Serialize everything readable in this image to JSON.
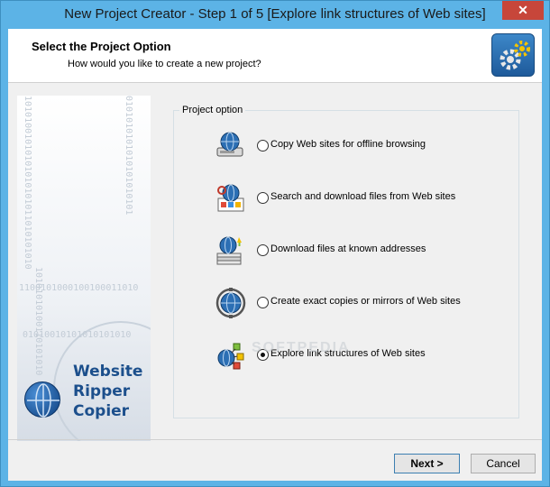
{
  "window": {
    "title": "New Project Creator - Step 1 of 5 [Explore link structures of Web sites]",
    "close_glyph": "✕"
  },
  "header": {
    "title": "Select the Project Option",
    "subtitle": "How would you like to create a new project?",
    "icon": "gears-icon"
  },
  "banner": {
    "bits_rows": [
      "1100101000100100011010",
      "01010010101010101010"
    ],
    "bits_columns": [
      "10101001010101010101011010101010",
      "0101010101010101010101",
      "10101010100110101010"
    ],
    "logo": [
      "Website",
      "Ripper",
      "Copier"
    ]
  },
  "group": {
    "legend": "Project option",
    "options": [
      {
        "label": "Copy Web sites for offline browsing",
        "icon": "globe-drive-icon",
        "checked": false
      },
      {
        "label": "Search and download files from Web sites",
        "icon": "globe-search-icon",
        "checked": false
      },
      {
        "label": "Download files at known addresses",
        "icon": "globe-stack-icon",
        "checked": false
      },
      {
        "label": "Create exact copies or mirrors of Web sites",
        "icon": "globe-mirror-icon",
        "checked": false
      },
      {
        "label": "Explore link structures of Web sites",
        "icon": "link-structure-icon",
        "checked": true
      }
    ]
  },
  "watermark": "SOFTPEDIA",
  "footer": {
    "next_label": "Next >",
    "cancel_label": "Cancel"
  },
  "colors": {
    "titlebar": "#5cb3e6",
    "close": "#c7463a",
    "logo_text": "#1c4f8c"
  }
}
